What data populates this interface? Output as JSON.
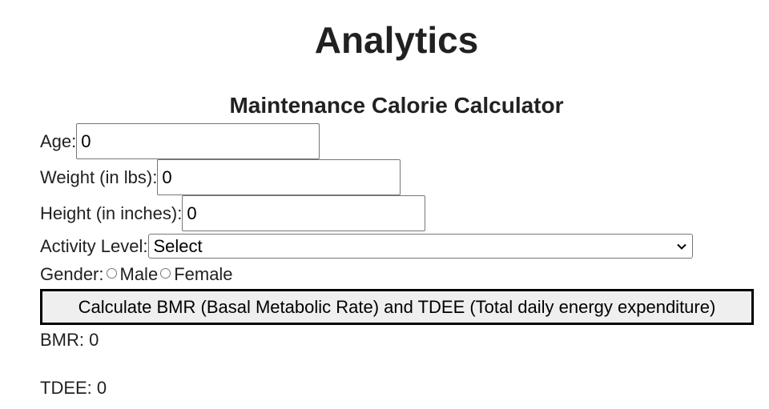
{
  "page": {
    "title": "Analytics"
  },
  "calculator": {
    "title": "Maintenance Calorie Calculator",
    "age": {
      "label": "Age:",
      "value": "0"
    },
    "weight": {
      "label": "Weight (in lbs):",
      "value": "0"
    },
    "height": {
      "label": "Height (in inches):",
      "value": "0"
    },
    "activity": {
      "label": "Activity Level:",
      "selected": "Select"
    },
    "gender": {
      "label": "Gender:",
      "options": [
        "Male",
        "Female"
      ]
    },
    "button_label": "Calculate BMR (Basal Metabolic Rate) and TDEE (Total daily energy expenditure)",
    "results": {
      "bmr_label": "BMR:",
      "bmr_value": "0",
      "tdee_label": "TDEE:",
      "tdee_value": "0"
    }
  },
  "icons": {
    "dropdown": "chevron-down-icon",
    "radio": "radio-unchecked-icon"
  }
}
